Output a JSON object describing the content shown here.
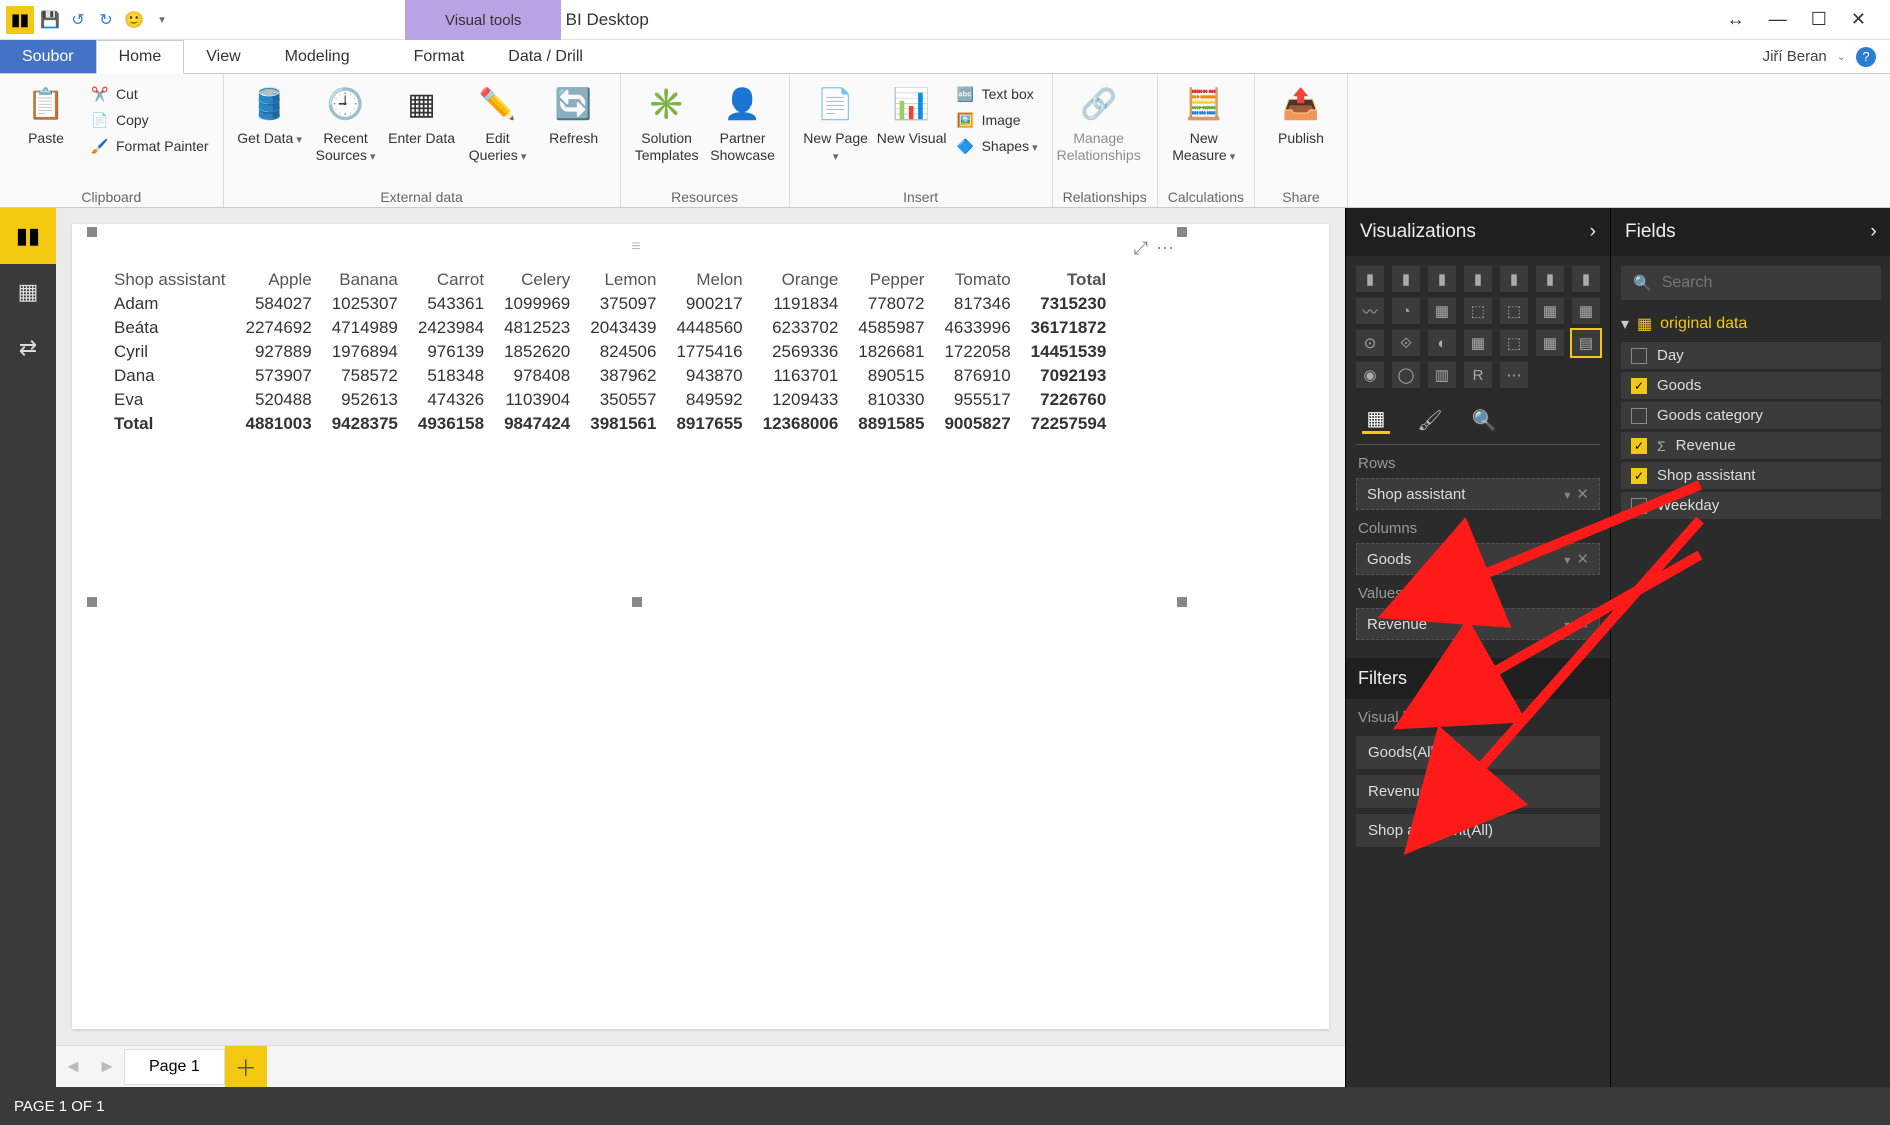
{
  "titlebar": {
    "visual_tools": "Visual tools",
    "title": "Untitled - Power BI Desktop"
  },
  "user": {
    "name": "Jiří Beran"
  },
  "tabs": {
    "file": "Soubor",
    "home": "Home",
    "view": "View",
    "modeling": "Modeling",
    "format": "Format",
    "data_drill": "Data / Drill"
  },
  "ribbon": {
    "clipboard": {
      "label": "Clipboard",
      "paste": "Paste",
      "cut": "Cut",
      "copy": "Copy",
      "format_painter": "Format Painter"
    },
    "external": {
      "label": "External data",
      "get_data": "Get Data",
      "recent_sources": "Recent Sources",
      "enter_data": "Enter Data",
      "edit_queries": "Edit Queries",
      "refresh": "Refresh"
    },
    "resources": {
      "label": "Resources",
      "solution_templates": "Solution Templates",
      "partner_showcase": "Partner Showcase"
    },
    "insert": {
      "label": "Insert",
      "new_page": "New Page",
      "new_visual": "New Visual",
      "text_box": "Text box",
      "image": "Image",
      "shapes": "Shapes"
    },
    "relationships": {
      "label": "Relationships",
      "manage_relationships": "Manage Relationships"
    },
    "calculations": {
      "label": "Calculations",
      "new_measure": "New Measure"
    },
    "share": {
      "label": "Share",
      "publish": "Publish"
    }
  },
  "chart_data": {
    "type": "table",
    "row_field": "Shop assistant",
    "column_field": "Goods",
    "value_field": "Revenue",
    "columns": [
      "Apple",
      "Banana",
      "Carrot",
      "Celery",
      "Lemon",
      "Melon",
      "Orange",
      "Pepper",
      "Tomato"
    ],
    "rows": [
      {
        "name": "Adam",
        "values": [
          584027,
          1025307,
          543361,
          1099969,
          375097,
          900217,
          1191834,
          778072,
          817346
        ],
        "total": 7315230
      },
      {
        "name": "Beáta",
        "values": [
          2274692,
          4714989,
          2423984,
          4812523,
          2043439,
          4448560,
          6233702,
          4585987,
          4633996
        ],
        "total": 36171872
      },
      {
        "name": "Cyril",
        "values": [
          927889,
          1976894,
          976139,
          1852620,
          824506,
          1775416,
          2569336,
          1826681,
          1722058
        ],
        "total": 14451539
      },
      {
        "name": "Dana",
        "values": [
          573907,
          758572,
          518348,
          978408,
          387962,
          943870,
          1163701,
          890515,
          876910
        ],
        "total": 7092193
      },
      {
        "name": "Eva",
        "values": [
          520488,
          952613,
          474326,
          1103904,
          350557,
          849592,
          1209433,
          810330,
          955517
        ],
        "total": 7226760
      }
    ],
    "column_totals": [
      4881003,
      9428375,
      4936158,
      9847424,
      3981561,
      8917655,
      12368006,
      8891585,
      9005827
    ],
    "grand_total": 72257594,
    "total_label": "Total"
  },
  "page_tabs": {
    "page1": "Page 1"
  },
  "statusbar": {
    "text": "PAGE 1 OF 1"
  },
  "viz_pane": {
    "title": "Visualizations",
    "rows_label": "Rows",
    "columns_label": "Columns",
    "values_label": "Values",
    "rows_item": "Shop assistant",
    "columns_item": "Goods",
    "values_item": "Revenue",
    "filters_title": "Filters",
    "visual_filters_label": "Visual level filters",
    "filter1": "Goods(All)",
    "filter2": "Revenue(All)",
    "filter3": "Shop assistant(All)"
  },
  "fields_pane": {
    "title": "Fields",
    "search_placeholder": "Search",
    "table": "original data",
    "fields": [
      {
        "name": "Day",
        "checked": false,
        "sigma": false
      },
      {
        "name": "Goods",
        "checked": true,
        "sigma": false
      },
      {
        "name": "Goods category",
        "checked": false,
        "sigma": false
      },
      {
        "name": "Revenue",
        "checked": true,
        "sigma": true
      },
      {
        "name": "Shop assistant",
        "checked": true,
        "sigma": false
      },
      {
        "name": "Weekday",
        "checked": false,
        "sigma": false
      }
    ]
  }
}
